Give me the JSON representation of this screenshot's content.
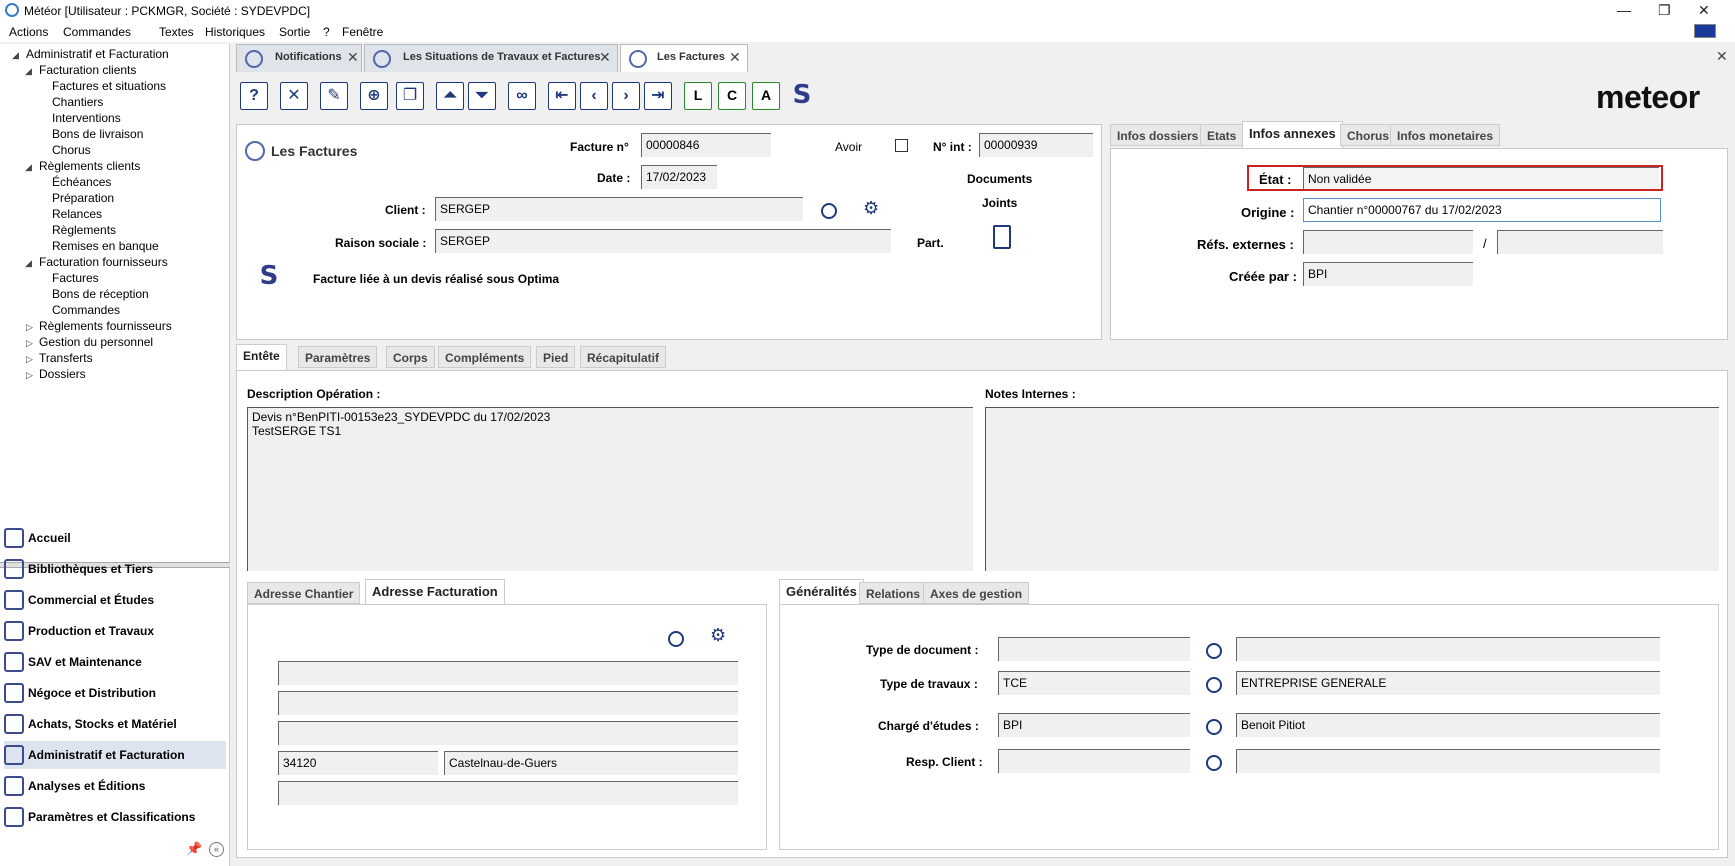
{
  "window": {
    "title": "Météor [Utilisateur : PCKMGR, Société : SYDEVPDC]"
  },
  "menu": [
    "Actions",
    "Commandes",
    "Textes",
    "Historiques",
    "Sortie",
    "?",
    "Fenêtre"
  ],
  "tree": {
    "root": "Administratif et Facturation",
    "facturation_clients": "Facturation clients",
    "fc_items": [
      "Factures et situations",
      "Chantiers",
      "Interventions",
      "Bons de livraison",
      "Chorus"
    ],
    "reglements_clients": "Règlements clients",
    "rc_items": [
      "Échéances",
      "Préparation",
      "Relances",
      "Règlements",
      "Remises en banque"
    ],
    "facturation_fournisseurs": "Facturation fournisseurs",
    "ff_items": [
      "Factures",
      "Bons de réception",
      "Commandes"
    ],
    "others": [
      "Règlements fournisseurs",
      "Gestion du personnel",
      "Transferts",
      "Dossiers"
    ]
  },
  "nav": [
    "Accueil",
    "Bibliothèques et Tiers",
    "Commercial et Études",
    "Production et Travaux",
    "SAV et Maintenance",
    "Négoce et Distribution",
    "Achats, Stocks et Matériel",
    "Administratif et Facturation",
    "Analyses et Éditions",
    "Paramètres et Classifications"
  ],
  "tabs": [
    "Notifications",
    "Les Situations de Travaux et Factures",
    "Les Factures"
  ],
  "logo": "meteor",
  "header": {
    "title": "Les Factures",
    "facture_label": "Facture n°",
    "facture_value": "00000846",
    "avoir_label": "Avoir",
    "nint_label": "N° int :",
    "nint_value": "00000939",
    "date_label": "Date :",
    "date_value": "17/02/2023",
    "documents": "Documents",
    "joints": "Joints",
    "client_label": "Client :",
    "client_value": "SERGEP",
    "raison_label": "Raison sociale :",
    "raison_value": "SERGEP",
    "part_label": "Part.",
    "optima_text": "Facture liée à un devis réalisé sous Optima"
  },
  "right_tabs": [
    "Infos dossiers",
    "Etats",
    "Infos annexes",
    "Chorus",
    "Infos monetaires"
  ],
  "annexes": {
    "etat_label": "État :",
    "etat_value": "Non validée",
    "origine_label": "Origine :",
    "origine_value": "Chantier n°00000767 du 17/02/2023",
    "refs_label": "Réfs. externes :",
    "refs_sep": "/",
    "creee_label": "Créée par :",
    "creee_value": "BPI"
  },
  "body_tabs": [
    "Entête",
    "Paramètres",
    "Corps",
    "Compléments",
    "Pied",
    "Récapitulatif"
  ],
  "body": {
    "desc_label": "Description Opération :",
    "desc_value": "Devis n°BenPITI-00153e23_SYDEVPDC du 17/02/2023\nTestSERGE TS1",
    "notes_label": "Notes Internes :"
  },
  "addr_tabs": [
    "Adresse Chantier",
    "Adresse Facturation"
  ],
  "address": {
    "cp": "34120",
    "ville": "Castelnau-de-Guers"
  },
  "gen_tabs": [
    "Généralités",
    "Relations",
    "Axes de gestion"
  ],
  "gen": {
    "type_doc_label": "Type de document :",
    "type_trav_label": "Type de travaux :",
    "type_trav_code": "TCE",
    "type_trav_value": "ENTREPRISE GENERALE",
    "charge_label": "Chargé d'études :",
    "charge_code": "BPI",
    "charge_value": "Benoit Pitiot",
    "resp_label": "Resp. Client :"
  },
  "colors": {
    "accent": "#1f3a7a",
    "highlight": "#cc2222"
  }
}
